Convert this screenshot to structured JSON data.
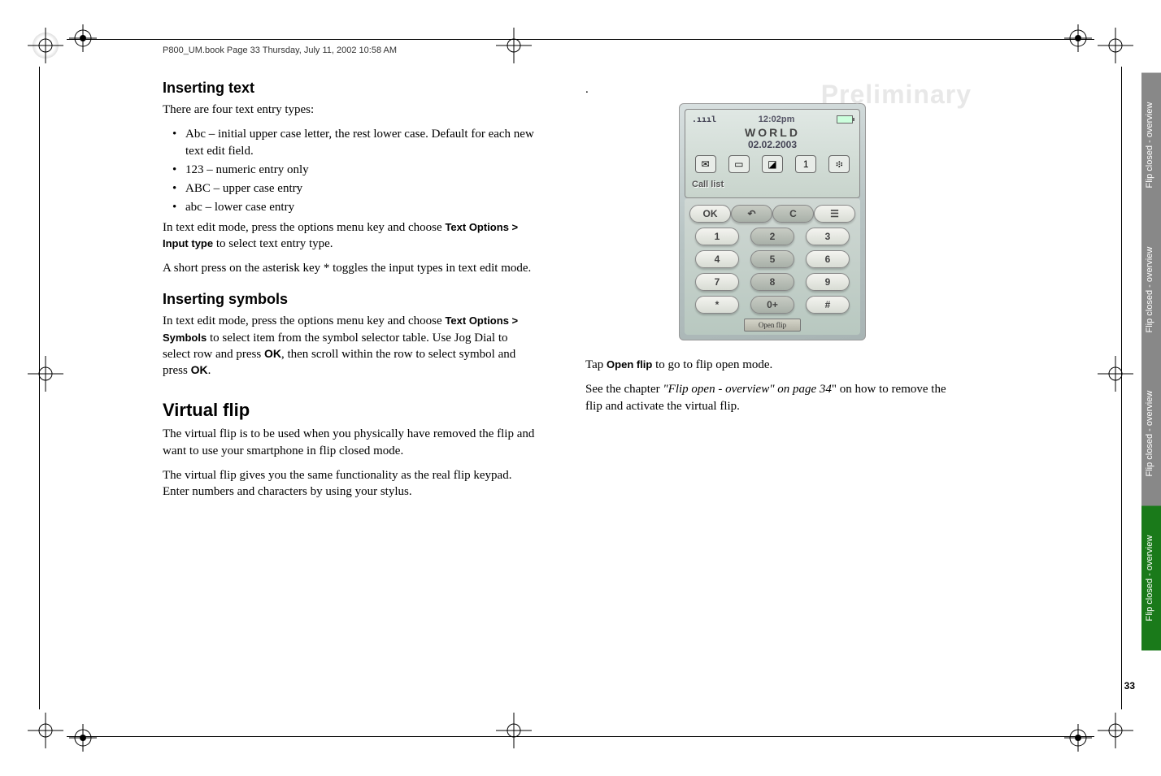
{
  "header": "P800_UM.book  Page 33  Thursday, July 11, 2002  10:58 AM",
  "watermark": "Preliminary",
  "left": {
    "h3a": "Inserting text",
    "p1": "There are four text entry types:",
    "bullets": [
      "Abc – initial upper case letter, the rest lower case. Default for each new text edit field.",
      "123 – numeric entry only",
      "ABC – upper case entry",
      "abc – lower case entry"
    ],
    "p2a": "In text edit mode, press the options menu key and choose ",
    "p2b": "Text Options > Input type",
    "p2c": " to select text entry type.",
    "p3": "A short press on the asterisk key *  toggles the input types in text edit mode.",
    "h3b": "Inserting symbols",
    "p4a": "In text edit mode, press the options menu key and choose ",
    "p4b": "Text Options > Symbols",
    "p4c": " to select item from the symbol selector table. Use Jog Dial to select row and press ",
    "p4d": "OK",
    "p4e": ", then scroll within the row to select symbol and press ",
    "p4f": "OK",
    "p4g": ".",
    "h2": "Virtual flip",
    "p5": "The virtual flip is to be used when you physically have removed the flip and want to use your smartphone in flip closed mode.",
    "p6": "The virtual flip gives you the same functionality as the real flip keypad. Enter numbers and characters by using your stylus."
  },
  "right": {
    "dot": ".",
    "p1a": "Tap ",
    "p1b": "Open flip",
    "p1c": " to go to flip open mode.",
    "p2a": "See the chapter ",
    "p2b": "\"Flip open - overview\" on page 34",
    "p2c": "\" on how to remove the flip and activate the virtual flip."
  },
  "phone": {
    "time": "12:02pm",
    "title": "WORLD",
    "date": "02.02.2003",
    "call_list": "Call list",
    "keys": {
      "r1": [
        "OK",
        "↶",
        "C",
        "☰"
      ],
      "r2": [
        "1",
        "2",
        "3"
      ],
      "r3": [
        "4",
        "5",
        "6"
      ],
      "r4": [
        "7",
        "8",
        "9"
      ],
      "r5": [
        "*",
        "0+",
        "#"
      ]
    },
    "open_flip": "Open flip"
  },
  "tabs": [
    "Flip closed - overview",
    "Flip closed - overview",
    "Flip closed - overview",
    "Flip closed - overview"
  ],
  "page_num": "33"
}
